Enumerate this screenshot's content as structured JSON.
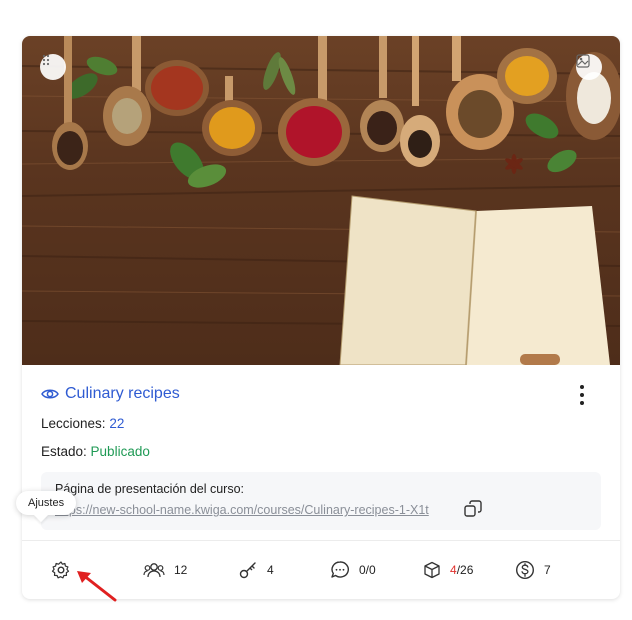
{
  "course": {
    "title": "Culinary recipes",
    "lessons_label": "Lecciones:",
    "lessons_value": "22",
    "status_label": "Estado:",
    "status_value": "Publicado",
    "page_label": "Página de presentación del curso:",
    "page_url": "https://new-school-name.kwiga.com/courses/Culinary-recipes-1-X1t"
  },
  "stats": {
    "students": "12",
    "keys": "4",
    "comments": "0/0",
    "tasks_done": "4",
    "tasks_total": "/26",
    "payments": "7"
  },
  "tooltip": {
    "settings": "Ajustes"
  },
  "colors": {
    "accent": "#2f5bd2",
    "published": "#1f9a55",
    "alert": "#e0302c",
    "arrow": "#e02020"
  }
}
